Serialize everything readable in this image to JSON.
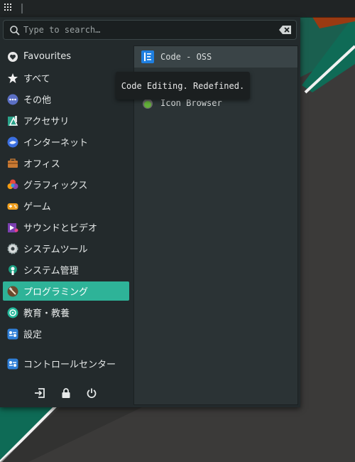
{
  "search": {
    "placeholder": "Type to search…",
    "value": ""
  },
  "categories": [
    {
      "label": "Favourites",
      "icon": "heart-icon"
    },
    {
      "label": "すべて",
      "icon": "star-icon"
    },
    {
      "label": "その他",
      "icon": "more-icon"
    },
    {
      "label": "アクセサリ",
      "icon": "accessories-icon"
    },
    {
      "label": "インターネット",
      "icon": "internet-icon"
    },
    {
      "label": "オフィス",
      "icon": "office-icon"
    },
    {
      "label": "グラフィックス",
      "icon": "graphics-icon"
    },
    {
      "label": "ゲーム",
      "icon": "gamepad-icon"
    },
    {
      "label": "サウンドとビデオ",
      "icon": "multimedia-icon"
    },
    {
      "label": "システムツール",
      "icon": "system-tools-icon"
    },
    {
      "label": "システム管理",
      "icon": "system-admin-icon"
    },
    {
      "label": "プログラミング",
      "icon": "programming-icon",
      "active": true
    },
    {
      "label": "教育・教養",
      "icon": "education-icon"
    },
    {
      "label": "設定",
      "icon": "settings-icon"
    }
  ],
  "control_center": {
    "label": "コントロールセンター",
    "icon": "control-center-icon"
  },
  "apps": [
    {
      "label": "Code - OSS",
      "icon": "vscode-icon"
    },
    {
      "label": "Icon Browser",
      "icon": "icon-browser-icon"
    }
  ],
  "tooltip": "Code Editing. Redefined.",
  "bottom_actions": [
    "logout-icon",
    "lock-icon",
    "power-icon"
  ],
  "colors": {
    "accent": "#2eb398",
    "menu_bg": "#232a2c",
    "panel_bg": "#202425"
  }
}
